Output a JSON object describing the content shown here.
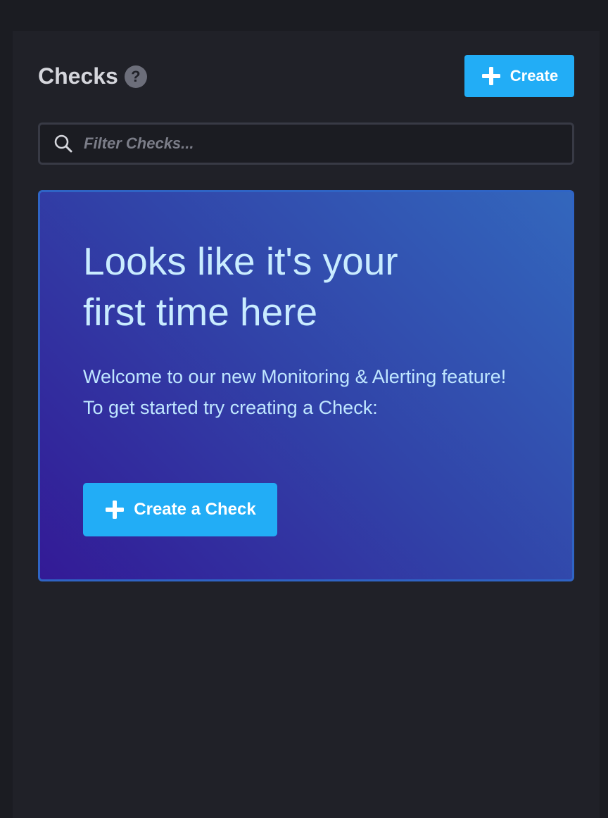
{
  "header": {
    "title": "Checks",
    "help_glyph": "?",
    "create_label": "Create"
  },
  "search": {
    "placeholder": "Filter Checks...",
    "value": ""
  },
  "welcome": {
    "heading_line1": "Looks like it's your",
    "heading_line2": "first time here",
    "body_line1": "Welcome to our new Monitoring & Alerting feature!",
    "body_line2": "To get started try creating a Check:",
    "cta_label": "Create a Check"
  },
  "icons": {
    "help": "question-circle-icon",
    "plus": "plus-icon",
    "search": "search-icon"
  },
  "colors": {
    "accent": "#22adf6",
    "panel": "#202128",
    "welcome_border": "#2f64c5"
  }
}
